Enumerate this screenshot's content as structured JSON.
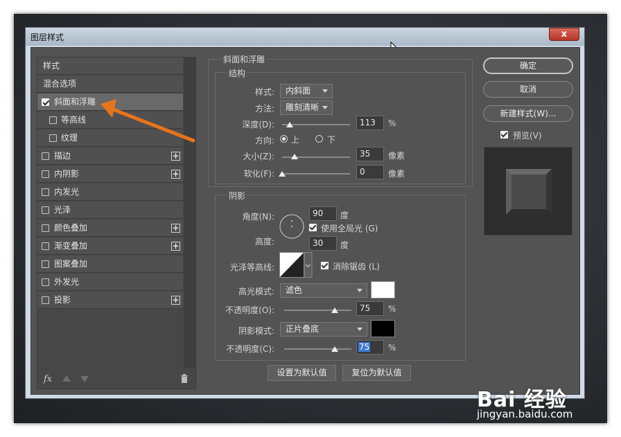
{
  "window": {
    "title": "图层样式",
    "close": "x"
  },
  "left_panel": {
    "items": [
      {
        "label": "样式",
        "checkbox": false,
        "checked": false,
        "plus": false,
        "sub": false,
        "selected": false
      },
      {
        "label": "混合选项",
        "checkbox": false,
        "checked": false,
        "plus": false,
        "sub": false,
        "selected": false
      },
      {
        "label": "斜面和浮雕",
        "checkbox": true,
        "checked": true,
        "plus": false,
        "sub": false,
        "selected": true
      },
      {
        "label": "等高线",
        "checkbox": true,
        "checked": false,
        "plus": false,
        "sub": true,
        "selected": false
      },
      {
        "label": "纹理",
        "checkbox": true,
        "checked": false,
        "plus": false,
        "sub": true,
        "selected": false
      },
      {
        "label": "描边",
        "checkbox": true,
        "checked": false,
        "plus": true,
        "sub": false,
        "selected": false
      },
      {
        "label": "内阴影",
        "checkbox": true,
        "checked": false,
        "plus": true,
        "sub": false,
        "selected": false
      },
      {
        "label": "内发光",
        "checkbox": true,
        "checked": false,
        "plus": false,
        "sub": false,
        "selected": false
      },
      {
        "label": "光泽",
        "checkbox": true,
        "checked": false,
        "plus": false,
        "sub": false,
        "selected": false
      },
      {
        "label": "颜色叠加",
        "checkbox": true,
        "checked": false,
        "plus": true,
        "sub": false,
        "selected": false
      },
      {
        "label": "渐变叠加",
        "checkbox": true,
        "checked": false,
        "plus": true,
        "sub": false,
        "selected": false
      },
      {
        "label": "图案叠加",
        "checkbox": true,
        "checked": false,
        "plus": false,
        "sub": false,
        "selected": false
      },
      {
        "label": "外发光",
        "checkbox": true,
        "checked": false,
        "plus": false,
        "sub": false,
        "selected": false
      },
      {
        "label": "投影",
        "checkbox": true,
        "checked": false,
        "plus": true,
        "sub": false,
        "selected": false
      }
    ],
    "fx": "fx"
  },
  "bevel": {
    "section_title": "斜面和浮雕",
    "structure_title": "结构",
    "style_label": "样式:",
    "style_value": "内斜面",
    "method_label": "方法:",
    "method_value": "雕刻清晰",
    "depth_label": "深度(D):",
    "depth_value": "113",
    "depth_unit": "%",
    "depth_fraction": 0.11,
    "direction_label": "方向:",
    "dir_up": "上",
    "dir_down": "下",
    "size_label": "大小(Z):",
    "size_value": "35",
    "size_unit": "像素",
    "size_fraction": 0.18,
    "soften_label": "软化(F):",
    "soften_value": "0",
    "soften_unit": "像素",
    "soften_fraction": 0.0
  },
  "shading": {
    "title": "阴影",
    "angle_label": "角度(N):",
    "angle_value": "90",
    "angle_unit": "度",
    "global_light": "使用全局光 (G)",
    "altitude_label": "高度:",
    "altitude_value": "30",
    "altitude_unit": "度",
    "gloss_label": "光泽等高线:",
    "antialias": "消除锯齿 (L)",
    "highlight_label": "高光模式:",
    "highlight_value": "滤色",
    "highlight_color": "#ffffff",
    "hl_opacity_label": "不透明度(O):",
    "hl_opacity_value": "75",
    "hl_opacity_unit": "%",
    "hl_opacity_fraction": 0.75,
    "shadow_label": "阴影模式:",
    "shadow_value": "正片叠底",
    "shadow_color": "#000000",
    "sh_opacity_label": "不透明度(C):",
    "sh_opacity_value": "75",
    "sh_opacity_unit": "%",
    "sh_opacity_fraction": 0.75
  },
  "buttons": {
    "make_default": "设置为默认值",
    "reset_default": "复位为默认值",
    "ok": "确定",
    "cancel": "取消",
    "new_style": "新建样式(W)...",
    "preview": "预览(V)"
  },
  "watermark": {
    "brand": "Bai 经验",
    "url": "jingyan.baidu.com"
  }
}
